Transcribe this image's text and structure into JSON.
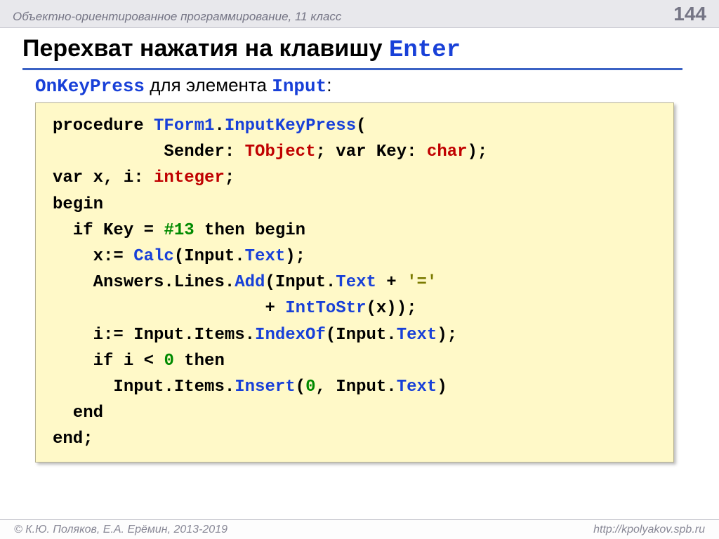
{
  "header": {
    "topic": "Объектно-ориентированное программирование, 11 класс",
    "page": "144"
  },
  "title": {
    "prefix": "Перехват нажатия на клавишу ",
    "mono": "Enter"
  },
  "subtitle": {
    "t1": "OnKeyPress",
    "t2": " для элемента ",
    "t3": "Input",
    "t4": ":"
  },
  "code": {
    "l1a": "procedure ",
    "l1b": "TForm1",
    "l1c": ".",
    "l1d": "InputKeyPress",
    "l1e": "(",
    "l2a": "           Sender: ",
    "l2b": "TObject",
    "l2c": "; var Key: ",
    "l2d": "char",
    "l2e": ");",
    "l3a": "var x, i: ",
    "l3b": "integer",
    "l3c": ";",
    "l4": "begin",
    "l5a": "  if Key = ",
    "l5b": "#13",
    "l5c": " then begin",
    "l6a": "    x:= ",
    "l6b": "Calc",
    "l6c": "(Input.",
    "l6d": "Text",
    "l6e": ");",
    "l7a": "    Answers.Lines.",
    "l7b": "Add",
    "l7c": "(Input.",
    "l7d": "Text",
    "l7e": " + ",
    "l7f": "'='",
    "l8a": "                     + ",
    "l8b": "IntToStr",
    "l8c": "(x));",
    "l9a": "    i:= Input.Items.",
    "l9b": "IndexOf",
    "l9c": "(Input.",
    "l9d": "Text",
    "l9e": ");",
    "l10a": "    if i < ",
    "l10b": "0",
    "l10c": " then",
    "l11a": "      Input.Items.",
    "l11b": "Insert",
    "l11c": "(",
    "l11d": "0",
    "l11e": ", Input.",
    "l11f": "Text",
    "l11g": ")",
    "l12": "  end",
    "l13": "end;"
  },
  "footer": {
    "left": "© К.Ю. Поляков, Е.А. Ерёмин, 2013-2019",
    "right": "http://kpolyakov.spb.ru"
  }
}
